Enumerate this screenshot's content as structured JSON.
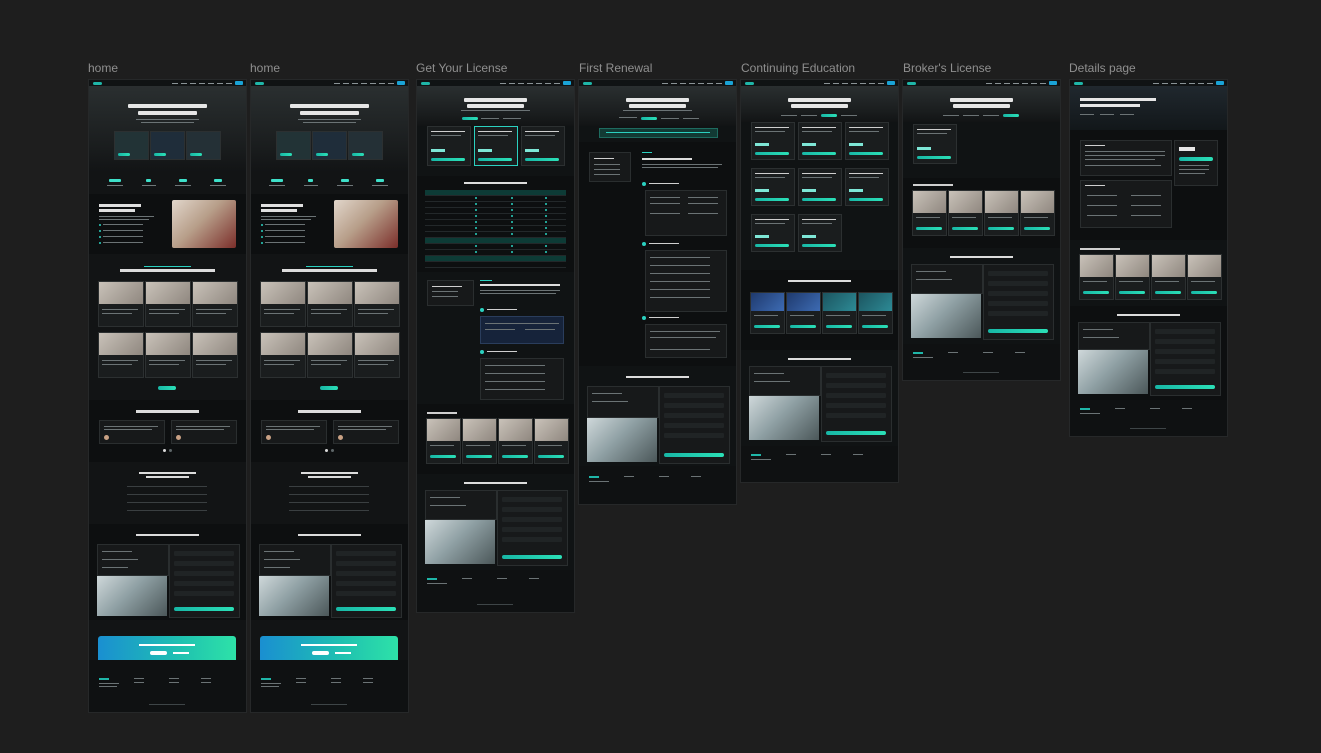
{
  "canvas": {
    "background": "#1e1e1e",
    "accent": "#2bd1c0",
    "cta_gradient": [
      "#1a8fd1",
      "#2ee2a8"
    ]
  },
  "frames": [
    {
      "label": "home"
    },
    {
      "label": "home"
    },
    {
      "label": "Get Your  License"
    },
    {
      "label": "First Renewal"
    },
    {
      "label": "Continuing Education"
    },
    {
      "label": "Broker's License"
    },
    {
      "label": "Details page"
    }
  ]
}
